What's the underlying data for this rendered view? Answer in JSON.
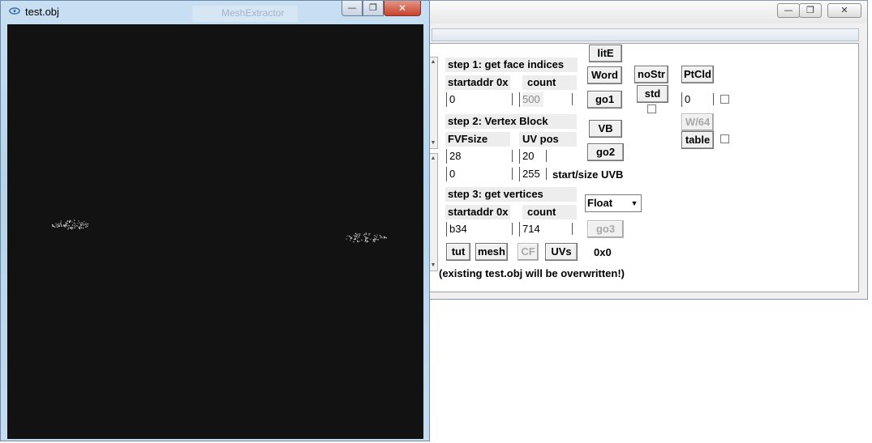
{
  "viewer_window": {
    "title": "test.obj",
    "background_title": "MeshExtractor",
    "minimize_glyph": "—",
    "restore_glyph": "❐",
    "close_glyph": "✕"
  },
  "extractor_window": {
    "minimize_glyph": "—",
    "restore_glyph": "❐",
    "close_glyph": "✕",
    "step1": {
      "header": "step 1: get face indices",
      "startaddr_label": "startaddr 0x",
      "count_label": "count",
      "startaddr_value": "0",
      "count_value": "500"
    },
    "step2": {
      "header": "step 2: Vertex Block",
      "fvfsize_label": "FVFsize",
      "uvpos_label": "UV pos",
      "fvfsize_value": "28",
      "uvpos_value": "20",
      "uvb_start_value": "0",
      "uvb_size_value": "255",
      "uvb_label": "start/size UVB"
    },
    "step3": {
      "header": "step 3: get vertices",
      "startaddr_label": "startaddr 0x",
      "count_label": "count",
      "startaddr_value": "b34",
      "count_value": "714"
    },
    "buttons": {
      "lite": "litE",
      "word": "Word",
      "go1": "go1",
      "vb": "VB",
      "go2": "go2",
      "go3": "go3",
      "nostr": "noStr",
      "std": "std",
      "ptcld": "PtCld",
      "w64": "W/64",
      "table": "table",
      "tut": "tut",
      "mesh": "mesh",
      "cf": "CF",
      "uvs": "UVs"
    },
    "ptcld_value": "0",
    "format_select": "Float",
    "dims_readout": "0x0",
    "note": "(existing test.obj will be overwritten!)"
  }
}
